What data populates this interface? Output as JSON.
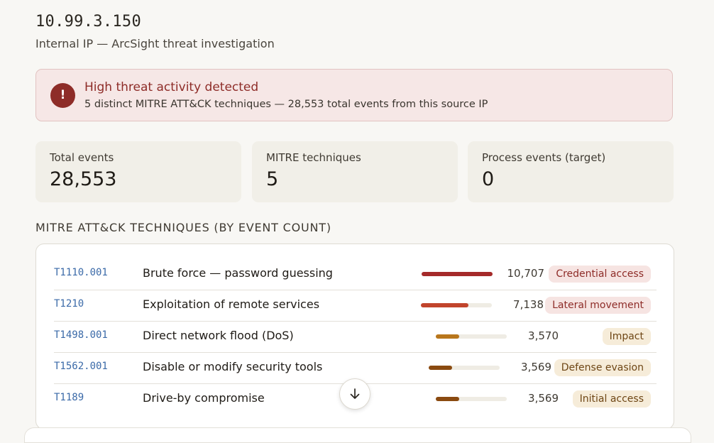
{
  "header": {
    "ip": "10.99.3.150",
    "subtitle": "Internal IP — ArcSight threat investigation"
  },
  "alert": {
    "icon": "exclamation-icon",
    "icon_glyph": "!",
    "title": "High threat activity detected",
    "text": "5 distinct MITRE ATT&CK techniques — 28,553 total events from this source IP",
    "color": "#8e2c28"
  },
  "stats": [
    {
      "label": "Total events",
      "value": "28,553"
    },
    {
      "label": "MITRE techniques",
      "value": "5"
    },
    {
      "label": "Process events (target)",
      "value": "0"
    }
  ],
  "section_title": "MITRE ATT&CK TECHNIQUES (BY EVENT COUNT)",
  "techniques": [
    {
      "id": "T1110.001",
      "name": "Brute force — password guessing",
      "count": "10,707",
      "fraction": 1.0,
      "bar_color": "#a52a2a",
      "tactic": "Credential access"
    },
    {
      "id": "T1210",
      "name": "Exploitation of remote services",
      "count": "7,138",
      "fraction": 0.67,
      "bar_color": "#c1442c",
      "tactic": "Lateral movement"
    },
    {
      "id": "T1498.001",
      "name": "Direct network flood (DoS)",
      "count": "3,570",
      "fraction": 0.33,
      "bar_color": "#b8761c",
      "tactic": "Impact"
    },
    {
      "id": "T1562.001",
      "name": "Disable or modify security tools",
      "count": "3,569",
      "fraction": 0.33,
      "bar_color": "#8a4a10",
      "tactic": "Defense evasion"
    },
    {
      "id": "T1189",
      "name": "Drive-by compromise",
      "count": "3,569",
      "fraction": 0.33,
      "bar_color": "#8a4a10",
      "tactic": "Initial access"
    }
  ],
  "scroll_button": {
    "icon": "arrow-down-icon"
  }
}
